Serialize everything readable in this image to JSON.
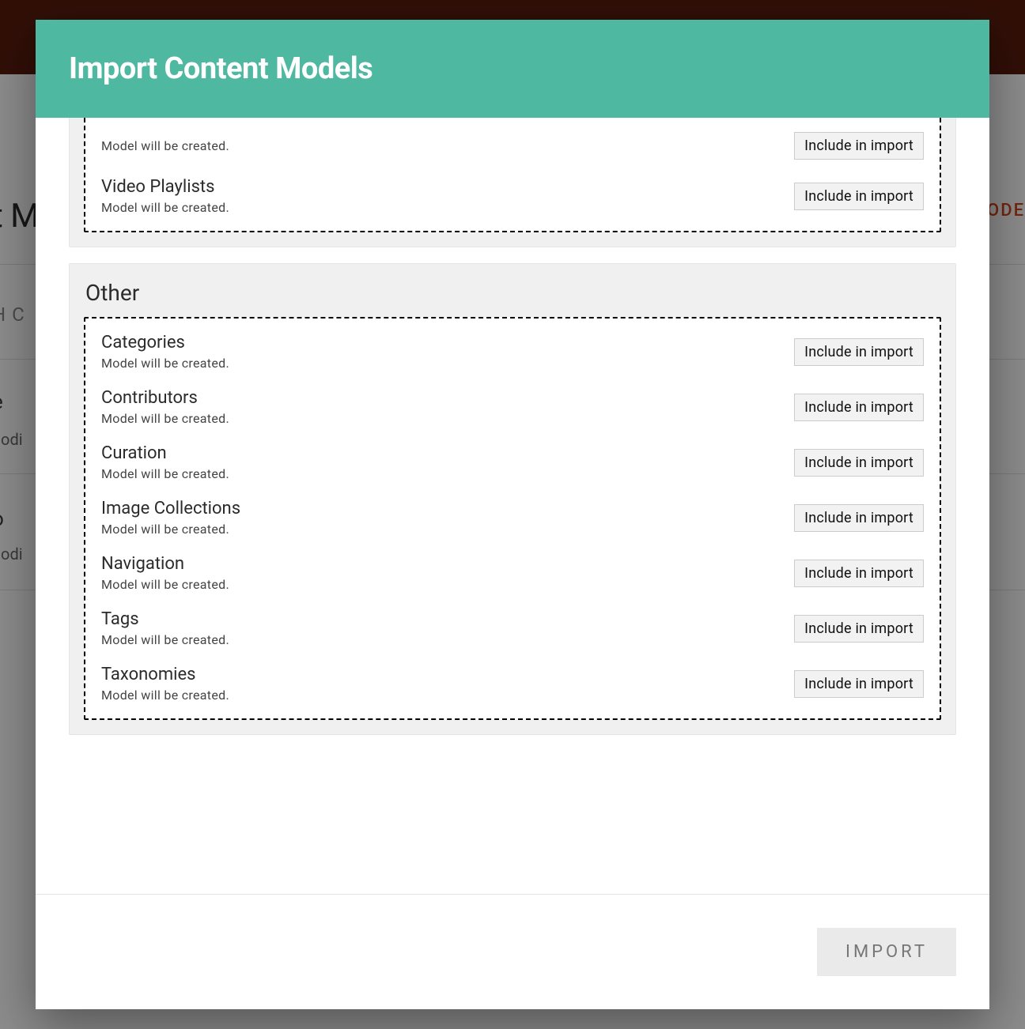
{
  "background": {
    "heading_fragment": "t M",
    "right_tab_fragment": "ODE",
    "search_fragment": "H C",
    "row1_label_fragment": "e",
    "row1_sub_fragment": "nodi",
    "row2_label_fragment": "o",
    "row2_sub_fragment": "nodi"
  },
  "modal": {
    "title": "Import Content Models",
    "import_button": "IMPORT",
    "include_label": "Include in import",
    "created_status": "Model will be created.",
    "groups": [
      {
        "title": "",
        "partial_top": true,
        "items": [
          {
            "name": ""
          },
          {
            "name": "Video Playlists"
          }
        ]
      },
      {
        "title": "Other",
        "partial_top": false,
        "items": [
          {
            "name": "Categories"
          },
          {
            "name": "Contributors"
          },
          {
            "name": "Curation"
          },
          {
            "name": "Image Collections"
          },
          {
            "name": "Navigation"
          },
          {
            "name": "Tags"
          },
          {
            "name": "Taxonomies"
          }
        ]
      }
    ]
  }
}
